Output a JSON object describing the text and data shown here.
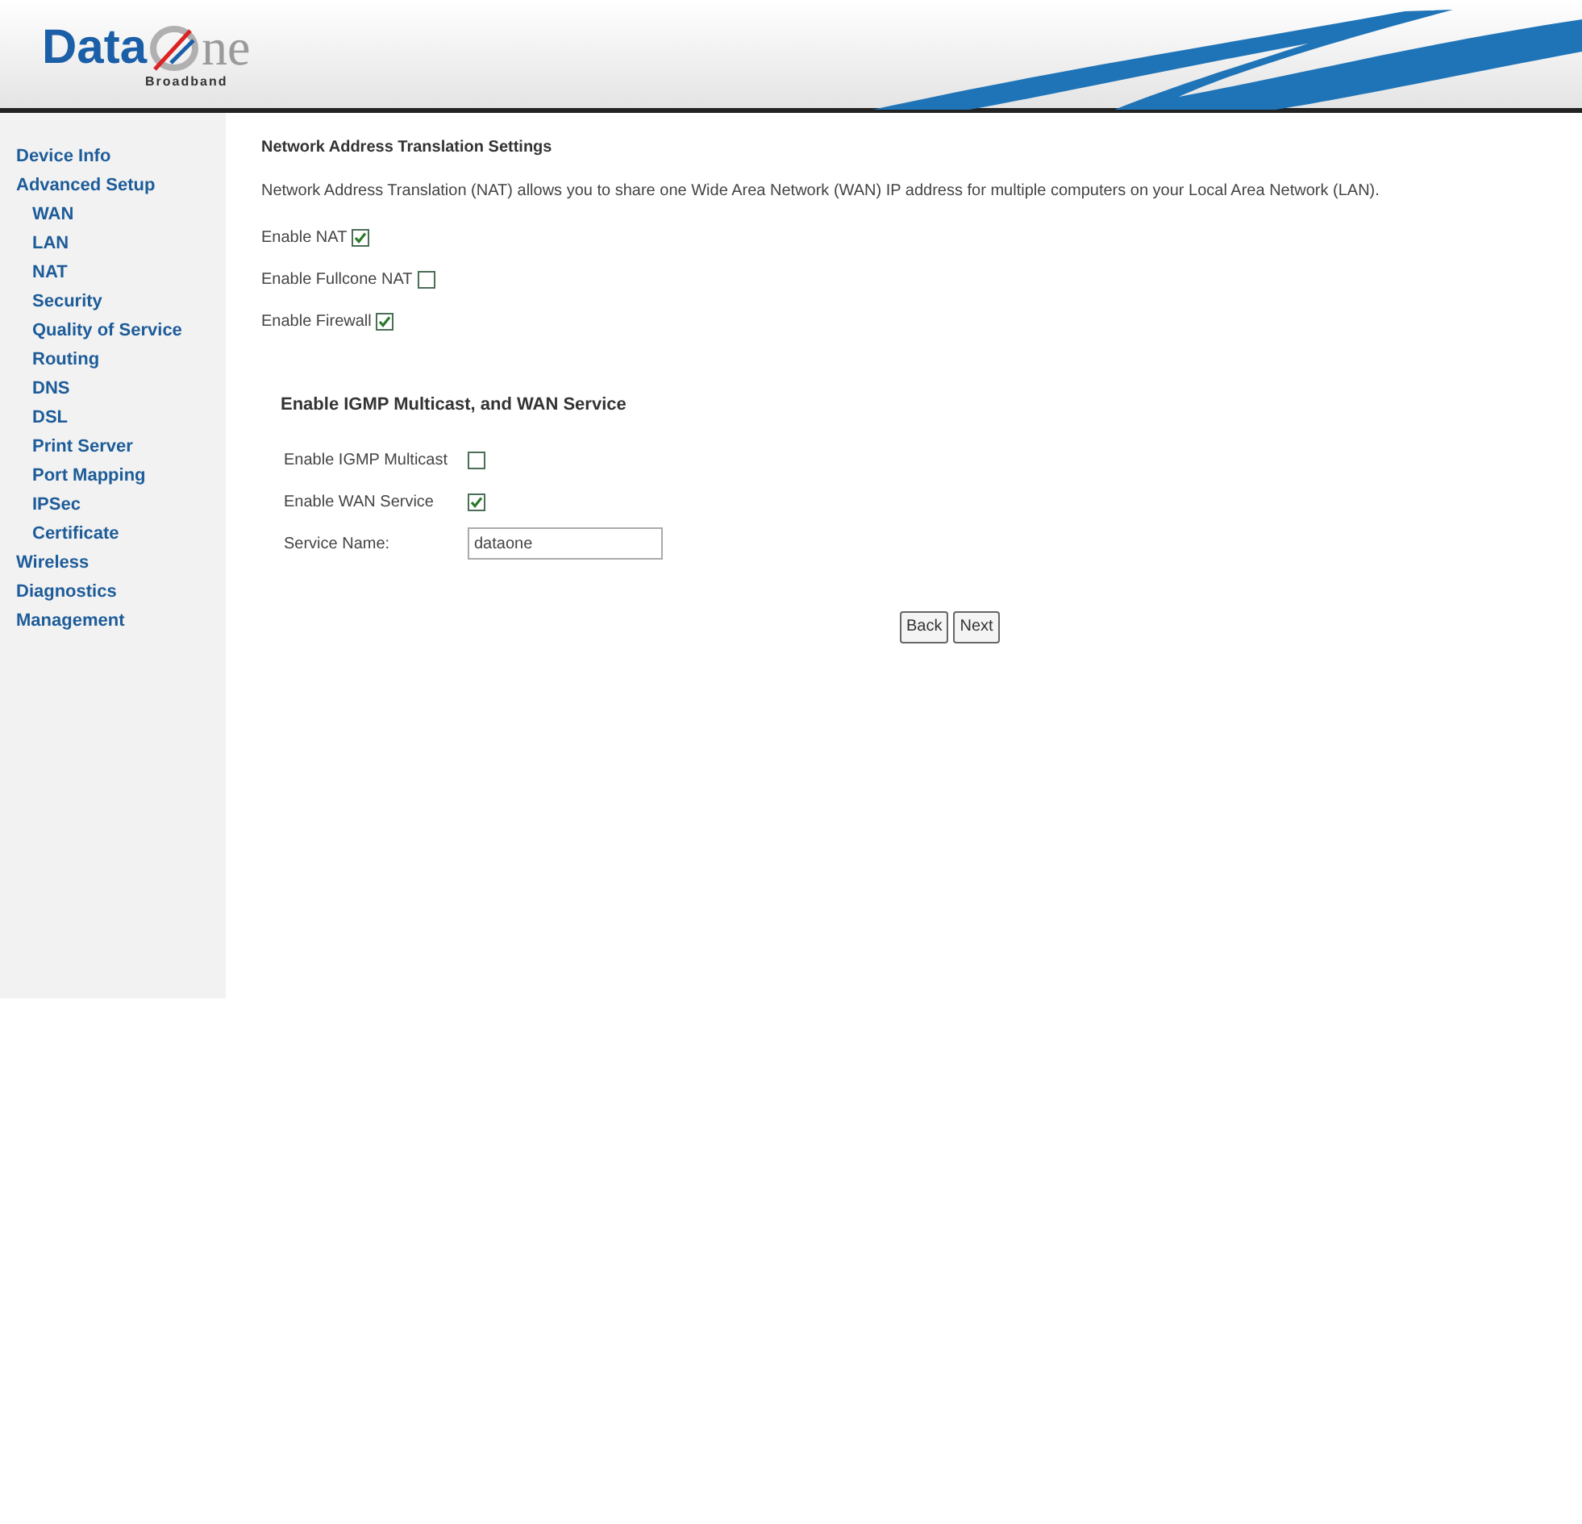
{
  "logo": {
    "word_left": "Data",
    "word_right": "ne",
    "tagline": "Broadband"
  },
  "sidebar": {
    "items": [
      {
        "label": "Device Info"
      },
      {
        "label": "Advanced Setup",
        "children": [
          {
            "label": "WAN"
          },
          {
            "label": "LAN"
          },
          {
            "label": "NAT"
          },
          {
            "label": "Security"
          },
          {
            "label": "Quality of Service"
          },
          {
            "label": "Routing"
          },
          {
            "label": "DNS"
          },
          {
            "label": "DSL"
          },
          {
            "label": "Print Server"
          },
          {
            "label": "Port Mapping"
          },
          {
            "label": "IPSec"
          },
          {
            "label": "Certificate"
          }
        ]
      },
      {
        "label": "Wireless"
      },
      {
        "label": "Diagnostics"
      },
      {
        "label": "Management"
      }
    ]
  },
  "nat": {
    "title": "Network Address Translation Settings",
    "description": "Network Address Translation (NAT) allows you to share one Wide Area Network (WAN) IP address for multiple computers on your Local Area Network (LAN).",
    "options": [
      {
        "label": "Enable NAT",
        "checked": true
      },
      {
        "label": "Enable Fullcone NAT",
        "checked": false
      },
      {
        "label": "Enable Firewall",
        "checked": true
      }
    ]
  },
  "igmp": {
    "title": "Enable IGMP Multicast, and WAN Service",
    "rows": [
      {
        "kind": "checkbox",
        "label": "Enable IGMP Multicast",
        "checked": false
      },
      {
        "kind": "checkbox",
        "label": "Enable WAN Service",
        "checked": true
      },
      {
        "kind": "text",
        "label": "Service Name:",
        "value": "dataone"
      }
    ]
  },
  "buttons": [
    "Back",
    "Next"
  ]
}
